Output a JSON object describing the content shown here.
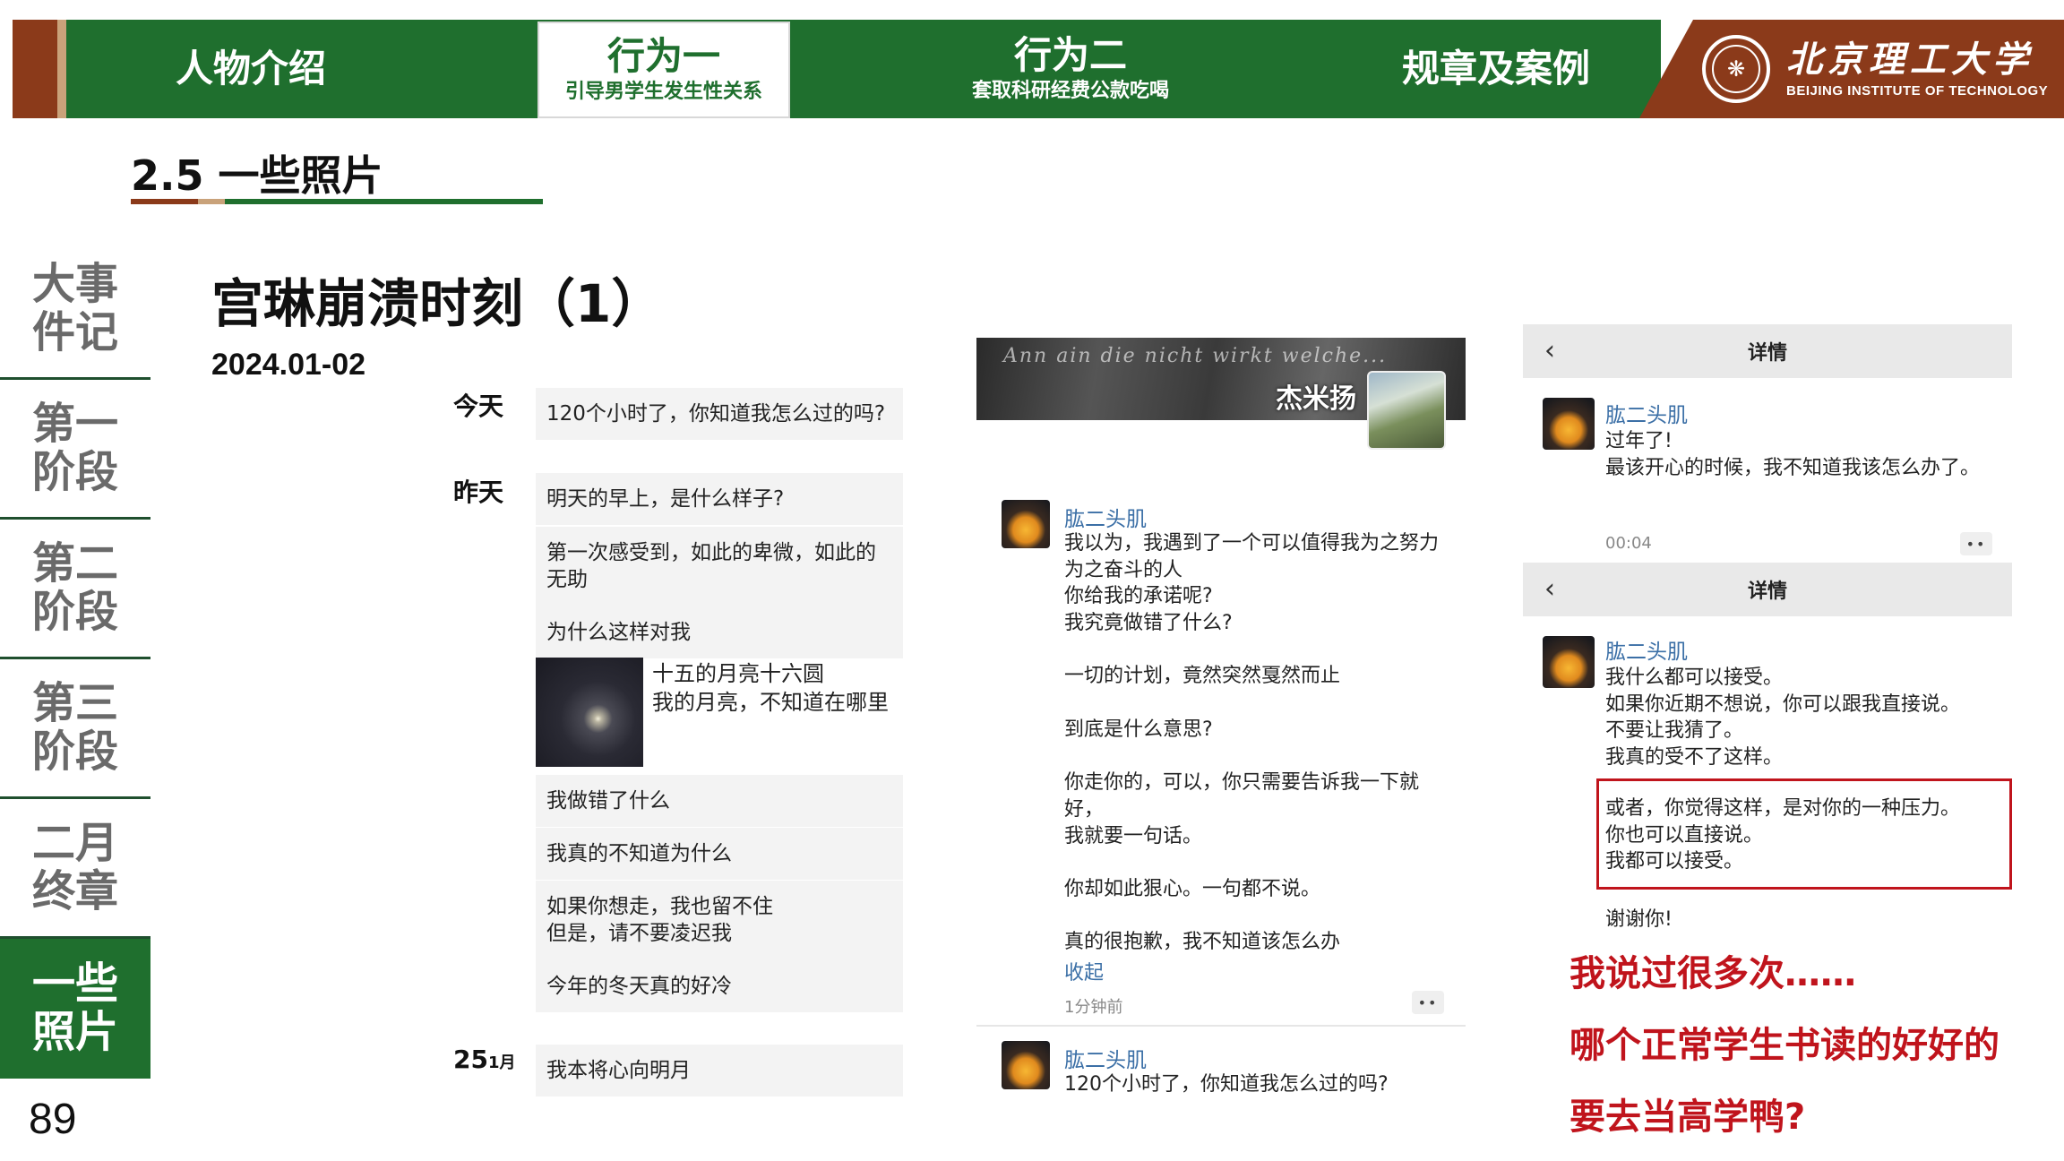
{
  "nav": {
    "tabs": [
      {
        "main": "人物介绍",
        "sub": ""
      },
      {
        "main": "行为一",
        "sub": "引导男学生发生性关系"
      },
      {
        "main": "行为二",
        "sub": "套取科研经费公款吃喝"
      },
      {
        "main": "规章及案例",
        "sub": ""
      }
    ],
    "brand_cn": "北京理工大学",
    "brand_en": "BEIJING INSTITUTE OF TECHNOLOGY"
  },
  "section_title": "2.5 一些照片",
  "sidebar": {
    "items": [
      "大事\n件记",
      "第一\n阶段",
      "第二\n阶段",
      "第三\n阶段",
      "二月\n终章",
      "一些\n照片"
    ],
    "active_index": 5
  },
  "page_number": "89",
  "main_title": "宫琳崩溃时刻（1）",
  "main_date": "2024.01-02",
  "chat": {
    "today_label": "今天",
    "yesterday_label": "昨天",
    "date_day": "25",
    "date_month": "1月",
    "messages": [
      "120个小时了，你知道我怎么过的吗?",
      "明天的早上，是什么样子?",
      "第一次感受到，如此的卑微，如此的无助",
      "为什么这样对我",
      "我做错了什么",
      "我真的不知道为什么",
      "如果你想走，我也留不住\n但是，请不要凌迟我",
      "今年的冬天真的好冷",
      "我本将心向明月"
    ],
    "image_caption": "十五的月亮十六圆\n我的月亮，不知道在哪里"
  },
  "weibo": {
    "banner_name": "杰米扬",
    "banner_script": "Ann ain die nicht wirkt welche...",
    "post1": {
      "name": "肱二头肌",
      "text": "我以为，我遇到了一个可以值得我为之努力为之奋斗的人\n你给我的承诺呢?\n我究竟做错了什么?\n\n一切的计划，竟然突然戛然而止\n\n到底是什么意思?\n\n你走你的，可以，你只需要告诉我一下就好，\n我就要一句话。\n\n你却如此狠心。一句都不说。\n\n真的很抱歉，我不知道该怎么办",
      "collapse": "收起",
      "time": "1分钟前"
    },
    "post2": {
      "name": "肱二头肌",
      "text": "120个小时了，你知道我怎么过的吗?"
    }
  },
  "right": {
    "detail1": {
      "title": "详情",
      "name": "肱二头肌",
      "text": "过年了!\n最该开心的时候，我不知道我该怎么办了。",
      "time": "00:04"
    },
    "detail2": {
      "title": "详情",
      "name": "肱二头肌",
      "text": "我什么都可以接受。\n如果你近期不想说，你可以跟我直接说。\n不要让我猜了。\n我真的受不了这样。",
      "boxed_text": "或者，你觉得这样，是对你的一种压力。\n你也可以直接说。\n我都可以接受。",
      "thanks": "谢谢你!"
    },
    "notes": [
      "我说过很多次……",
      "哪个正常学生书读的好好的",
      "要去当高学鸭?"
    ]
  },
  "colors": {
    "primary_green": "#1f6f2e",
    "brand_brown": "#8b3a1a",
    "accent_red": "#c0141c",
    "link_blue": "#3b6fa6"
  },
  "icons": [
    "back-chevron-icon",
    "more-dots-icon",
    "university-seal-icon"
  ]
}
